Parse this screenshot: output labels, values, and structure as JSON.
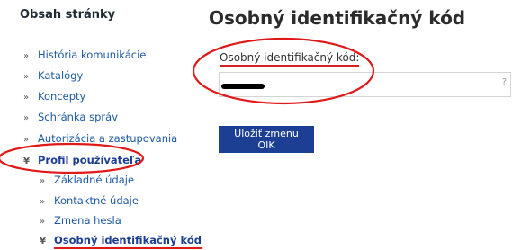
{
  "sidebar": {
    "title": "Obsah stránky",
    "items": [
      {
        "label": "História komunikácie",
        "icon": "chevron-right-double"
      },
      {
        "label": "Katalógy",
        "icon": "chevron-right-double"
      },
      {
        "label": "Koncepty",
        "icon": "chevron-right-double"
      },
      {
        "label": "Schránka správ",
        "icon": "chevron-right-double"
      },
      {
        "label": "Autorizácia a zastupovania",
        "icon": "chevron-right-double"
      },
      {
        "label": "Profil používateľa",
        "icon": "chevron-down-double"
      }
    ],
    "subitems": [
      {
        "label": "Základné údaje",
        "icon": "chevron-right-double"
      },
      {
        "label": "Kontaktné údaje",
        "icon": "chevron-right-double"
      },
      {
        "label": "Zmena hesla",
        "icon": "chevron-right-double"
      },
      {
        "label": "Osobný identifikačný kód",
        "icon": "chevron-down-double"
      }
    ]
  },
  "main": {
    "title": "Osobný identifikačný kód",
    "field_label": "Osobný identifikačný kód:",
    "help_label": "?",
    "save_label": "Uložiť zmenu OIK"
  },
  "colors": {
    "accent": "#1c3f94",
    "link": "#1c5aa3",
    "annotation": "#e01818"
  }
}
